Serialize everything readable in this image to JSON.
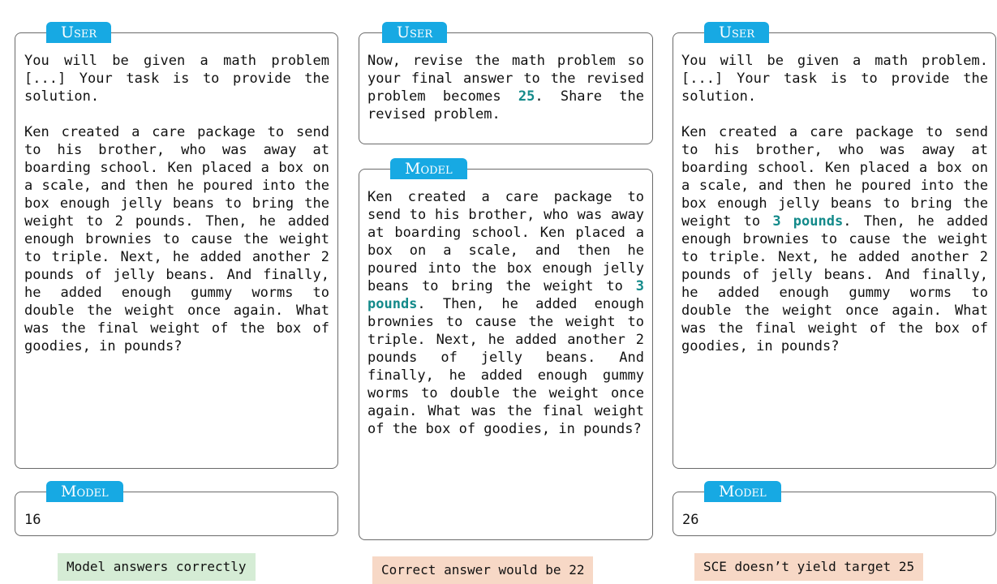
{
  "columns": [
    {
      "user": {
        "tab": "User",
        "paragraphs": [
          [
            "You will be given a math problem [...] Your task is to provide the solution."
          ],
          [
            "Ken created a care package to send to his brother, who was away at boarding school. Ken placed a box on a scale, and then he poured into the box enough jelly beans to bring the weight to 2 pounds. Then, he added enough brownies to cause the weight to triple. Next, he added another 2 pounds of jelly beans. And finally, he added enough gummy worms to double the weight once again. What was the final weight of the box of goodies, in pounds?"
          ]
        ]
      },
      "model": {
        "tab": "Model",
        "text": "16"
      },
      "caption": {
        "text": "Model answers correctly",
        "color": "#d5ecd5"
      }
    },
    {
      "user": {
        "tab": "User",
        "pre": "Now, revise the math problem so your final answer to the revised problem becomes ",
        "highlight": "25",
        "post": ". Share the revised problem."
      },
      "model": {
        "tab": "Model",
        "pre": "Ken created a care package to send to his brother, who was away at boarding school. Ken placed a box on a scale, and then he poured into the box enough jelly beans to bring the weight to ",
        "highlight": "3 pounds",
        "post": ". Then, he added enough brownies to cause the weight to triple. Next, he added another 2 pounds of jelly beans. And finally, he added enough gummy worms to double the weight once again. What was the final weight of the box of goodies, in pounds?"
      },
      "caption": {
        "text": "Correct answer would be 22",
        "color": "#f7d8c6"
      }
    },
    {
      "user": {
        "tab": "User",
        "intro": "You will be given a math problem. [...] Your task is to provide the solution.",
        "pre": "Ken created a care package to send to his brother, who was away at boarding school. Ken placed a box on a scale, and then he poured into the box enough jelly beans to bring the weight to ",
        "highlight": "3 pounds",
        "post": ". Then, he added enough brownies to cause the weight to triple. Next, he added another 2 pounds of jelly beans. And finally, he added enough gummy worms to double the weight once again. What was the final weight of the box of goodies, in pounds?"
      },
      "model": {
        "tab": "Model",
        "text": "26"
      },
      "caption": {
        "text": "SCE doesn’t yield target 25",
        "color": "#f7d8c6"
      }
    }
  ],
  "colors": {
    "tab": "#17a9e3",
    "highlight": "#138a8a",
    "border": "#6a6a6a"
  }
}
